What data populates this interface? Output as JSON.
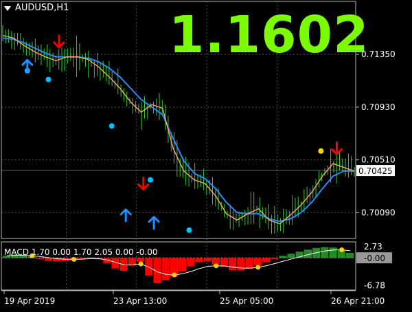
{
  "chart": {
    "symbol": "AUDUSD,H1",
    "current_price_big": "1.1602",
    "price_tag": "0.70425",
    "price_axis_ticks": [
      "0.71350",
      "0.70930",
      "0.70510",
      "0.70090"
    ],
    "price_range": [
      0.699,
      0.7175
    ],
    "time_ticks": [
      "19 Apr 2019",
      "23 Apr 13:00",
      "25 Apr 05:00",
      "26 Apr 21:00"
    ]
  },
  "macd": {
    "label": "MACD 1.70 0.00 1.70 2.05 0.00 -0.00",
    "axis_ticks": [
      "2.73",
      "-6.78"
    ],
    "current_tag": "-0.00",
    "range": [
      -7.5,
      3.2
    ]
  },
  "colors": {
    "candle": "#32cd32",
    "ma_fast": "#f4a460",
    "ma_slow": "#1e90ff",
    "dot": "#00bfff",
    "arrow_up": "#1e90ff",
    "arrow_down": "#ff0000",
    "big_price": "#7cfc00",
    "hist_up": "#228b22",
    "hist_down": "#ff0000",
    "signal_dot": "#ffd700"
  },
  "chart_data": {
    "type": "line",
    "series": [
      {
        "values": [
          0.715,
          0.7148,
          0.7142,
          0.7137,
          0.7133,
          0.713,
          0.7133,
          0.7133,
          0.7131,
          0.7125,
          0.7117,
          0.7108,
          0.7097,
          0.7089,
          0.7095,
          0.7092,
          0.706,
          0.7042,
          0.7035,
          0.7032,
          0.7022,
          0.7008,
          0.7003,
          0.7008,
          0.7012,
          0.7003,
          0.7,
          0.7007,
          0.7015,
          0.7025,
          0.7038,
          0.7048,
          0.7045,
          0.7042
        ]
      },
      {
        "values": [
          0.7148,
          0.7147,
          0.7144,
          0.714,
          0.7136,
          0.7133,
          0.7133,
          0.7133,
          0.7132,
          0.7129,
          0.7124,
          0.7117,
          0.7108,
          0.7099,
          0.7093,
          0.7087,
          0.7068,
          0.705,
          0.704,
          0.7036,
          0.7028,
          0.7017,
          0.7009,
          0.7008,
          0.7008,
          0.7004,
          0.7002,
          0.7004,
          0.7009,
          0.7017,
          0.7028,
          0.7038,
          0.7042,
          0.7042
        ]
      }
    ],
    "up_arrows": [
      [
        0.07,
        0.7122
      ],
      [
        0.35,
        0.7003
      ],
      [
        0.43,
        0.6997
      ]
    ],
    "down_arrows": [
      [
        0.16,
        0.714
      ],
      [
        0.4,
        0.7027
      ],
      [
        0.95,
        0.7055
      ]
    ],
    "dots": [
      [
        0.07,
        0.7122
      ],
      [
        0.13,
        0.7115
      ],
      [
        0.31,
        0.7078
      ],
      [
        0.42,
        0.7035
      ],
      [
        0.53,
        0.6995
      ]
    ],
    "macd_hist": [
      0.5,
      0.8,
      0.6,
      0.3,
      -0.2,
      -0.6,
      -0.8,
      -0.7,
      -0.4,
      -0.2,
      0.1,
      -0.3,
      -1.2,
      -2.5,
      -3.1,
      -1.8,
      -0.9,
      -4.2,
      -6.1,
      -5.4,
      -4.5,
      -3.2,
      -2.0,
      -1.0,
      -0.8,
      -1.6,
      -2.1,
      -2.9,
      -3.0,
      -2.6,
      -1.8,
      -1.0,
      -0.2,
      0.5,
      1.0,
      1.5,
      2.0,
      2.4,
      2.6,
      2.5,
      2.0,
      1.2
    ]
  }
}
